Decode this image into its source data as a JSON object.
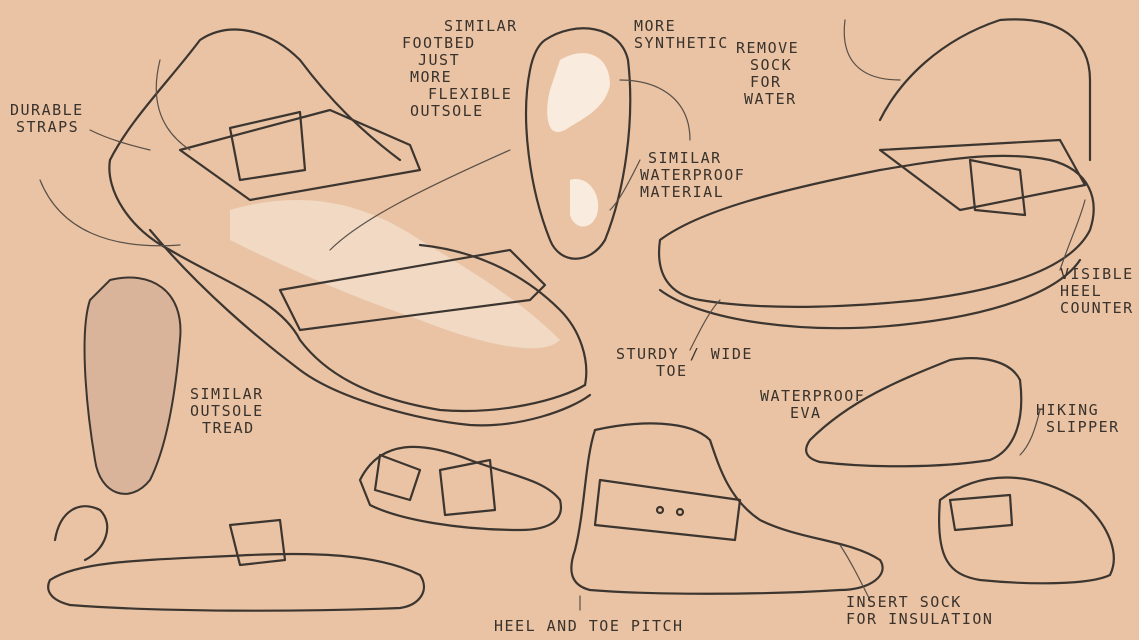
{
  "colors": {
    "paper": "#e9c3a3",
    "ink": "#3c3530",
    "highlight": "#f3e0cf"
  },
  "annotations": {
    "durable_straps": [
      "DURABLE",
      "STRAPS"
    ],
    "similar_footbed": [
      "SIMILAR",
      "FOOTBED",
      "JUST",
      "MORE",
      "FLEXIBLE",
      "OUTSOLE"
    ],
    "more_synthetic": [
      "MORE",
      "SYNTHETIC"
    ],
    "remove_sock": [
      "REMOVE",
      "SOCK",
      "FOR",
      "WATER"
    ],
    "similar_waterproof": [
      "SIMILAR",
      "WATERPROOF",
      "MATERIAL"
    ],
    "visible_heel": [
      "VISIBLE",
      "HEEL",
      "COUNTER"
    ],
    "similar_outsole": [
      "SIMILAR",
      "OUTSOLE",
      "TREAD"
    ],
    "sturdy_toe": [
      "STURDY / WIDE",
      "TOE"
    ],
    "waterproof_eva": [
      "WATERPROOF",
      "EVA"
    ],
    "hiking_slipper": [
      "HIKING",
      "SLIPPER"
    ],
    "heel_toe_pitch": "HEEL AND TOE PITCH",
    "insert_sock": [
      "INSERT SOCK",
      "FOR INSULATION"
    ]
  }
}
